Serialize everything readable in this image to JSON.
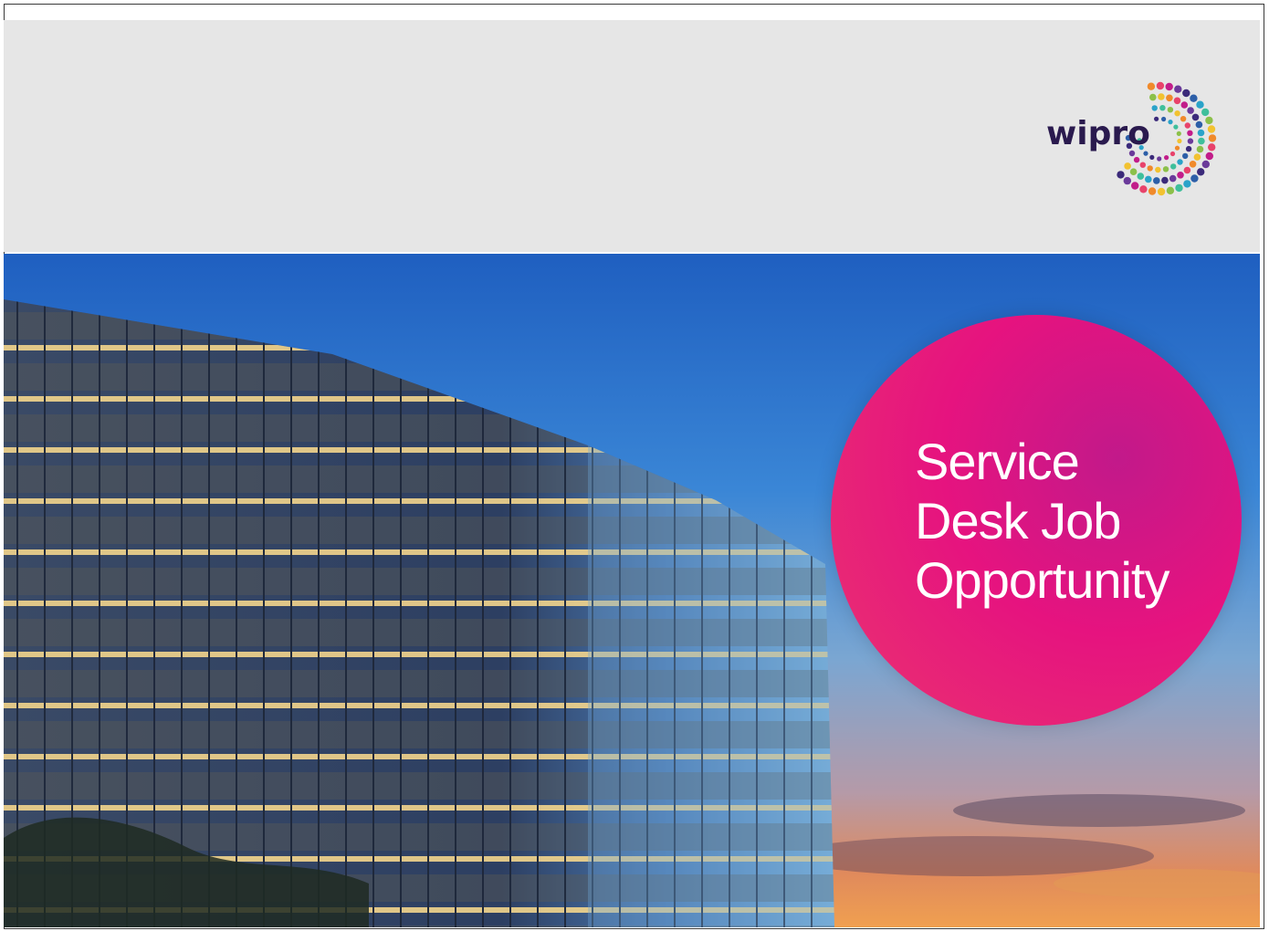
{
  "logo": {
    "text": "wipro",
    "icon": "wipro-dots-icon"
  },
  "promo": {
    "line1": "Service",
    "line2": "Desk Job",
    "line3": "Opportunity"
  },
  "colors": {
    "header_bg": "#e6e6e6",
    "circle_pink": "#e6137f",
    "circle_magenta": "#c2198a",
    "sky_blue": "#2f72c9",
    "text_white": "#ffffff"
  }
}
